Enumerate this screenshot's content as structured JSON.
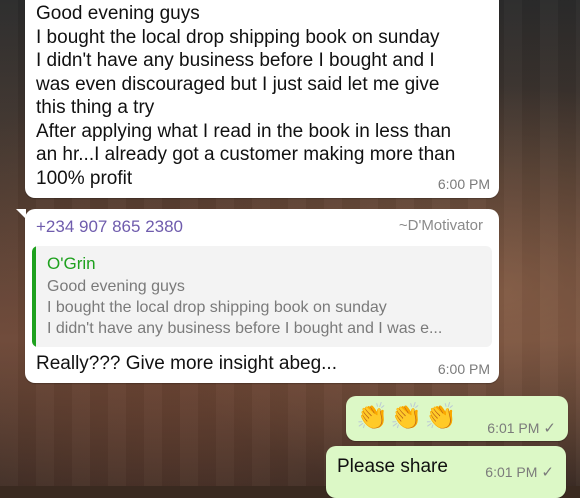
{
  "messages": [
    {
      "text": "Good evening guys\nI bought the local drop shipping book on sunday\nI didn't have any business before I bought and I\nwas even discouraged but I just said let me give\nthis thing a try\nAfter applying what I read in the book in less than\nan hr...I already got a customer making more than\n100% profit",
      "time": "6:00 PM"
    },
    {
      "sender": "+234 907 865 2380",
      "alias": "~D'Motivator",
      "quote": {
        "name": "O'Grin",
        "lines": [
          "Good evening guys",
          "I bought the local drop shipping book on sunday",
          "I didn't have any business before I bought and I was e..."
        ]
      },
      "text": "Really??? Give more insight abeg...",
      "time": "6:00 PM"
    },
    {
      "text": "👏👏👏",
      "time": "6:01 PM",
      "status": "✓"
    },
    {
      "text": "Please share",
      "time": "6:01 PM",
      "status": "✓"
    }
  ],
  "icons": {
    "read_receipt": "single-check-icon",
    "emoji": "clapping-hands-icon"
  }
}
